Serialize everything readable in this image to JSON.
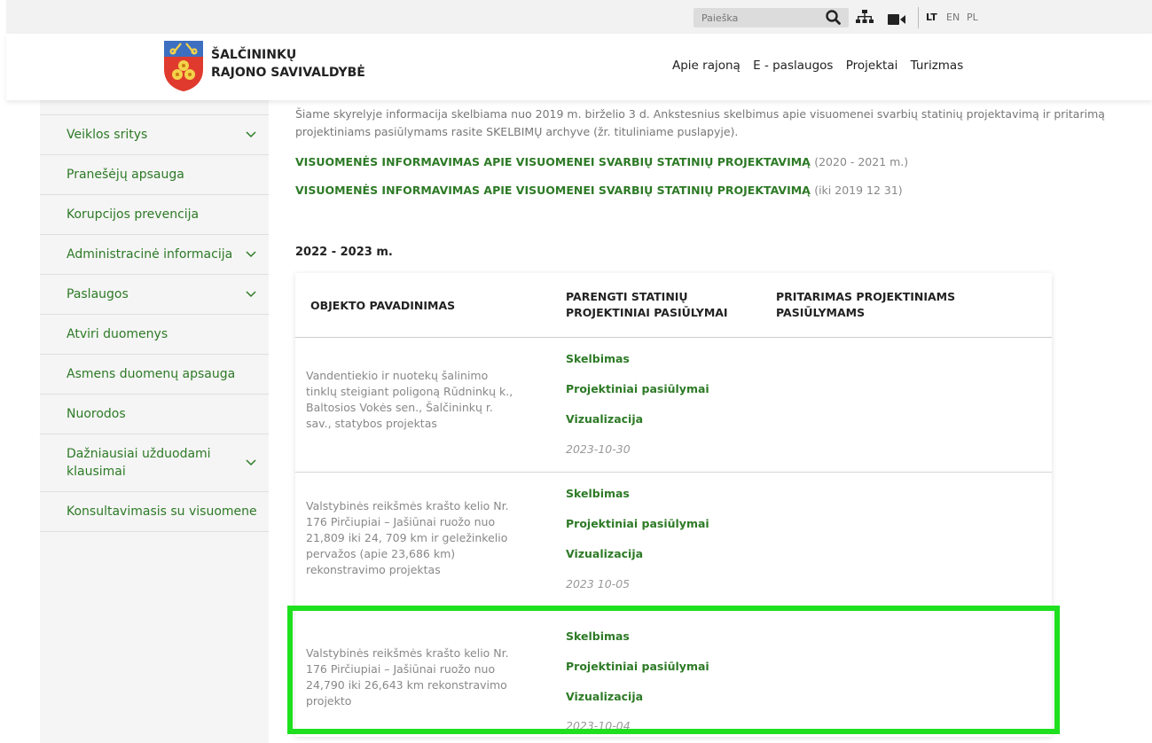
{
  "topbar": {
    "search_placeholder": "Paieška",
    "search_icon": "search-icon",
    "sitemap_icon": "sitemap-icon",
    "video_icon": "video-camera-icon",
    "languages": [
      "LT",
      "EN",
      "PL"
    ],
    "active_language": "LT"
  },
  "header": {
    "brand_line1": "ŠALČININKŲ",
    "brand_line2": "RAJONO SAVIVALDYBĖ",
    "nav": [
      "Apie rajoną",
      "E - paslaugos",
      "Projektai",
      "Turizmas"
    ]
  },
  "sidebar": {
    "items": [
      {
        "label": "Veiklos sritys",
        "expandable": true
      },
      {
        "label": "Pranešėjų apsauga",
        "expandable": false
      },
      {
        "label": "Korupcijos prevencija",
        "expandable": false
      },
      {
        "label": "Administracinė informacija",
        "expandable": true
      },
      {
        "label": "Paslaugos",
        "expandable": true
      },
      {
        "label": "Atviri duomenys",
        "expandable": false
      },
      {
        "label": "Asmens duomenų apsauga",
        "expandable": false
      },
      {
        "label": "Nuorodos",
        "expandable": false
      },
      {
        "label": "Dažniausiai užduodami klausimai",
        "expandable": true
      },
      {
        "label": "Konsultavimasis su visuomene",
        "expandable": false
      }
    ]
  },
  "content": {
    "intro": "Šiame skyrelyje informacija skelbiama nuo 2019 m. birželio 3 d. Ankstesnius skelbimus apie visuomenei svarbių statinių projektavimą ir pritarimą projektiniams pasiūlymams rasite SKELBIMŲ archyve (žr. tituliniame puslapyje).",
    "link1_text": "VISUOMENĖS INFORMAVIMAS APIE VISUOMENEI SVARBIŲ STATINIŲ PROJEKTAVIMĄ",
    "link1_years": "(2020 - 2021 m.)",
    "link2_text": "VISUOMENĖS INFORMAVIMAS APIE VISUOMENEI SVARBIŲ STATINIŲ PROJEKTAVIMĄ",
    "link2_years": "(iki 2019 12 31)",
    "year_heading": "2022 - 2023 m.",
    "table": {
      "headers": [
        "OBJEKTO PAVADINIMAS",
        "PARENGTI STATINIŲ PROJEKTINIAI PASIŪLYMAI",
        "PRITARIMAS PROJEKTINIAMS PASIŪLYMAMS"
      ],
      "rows": [
        {
          "object": "Vandentiekio ir nuotekų šalinimo tinklų steigiant poligoną Rūdninkų k., Baltosios Vokės sen., Šalčininkų r. sav., statybos projektas",
          "links": [
            "Skelbimas",
            "Projektiniai pasiūlymai",
            "Vizualizacija"
          ],
          "date": "2023-10-30"
        },
        {
          "object": "Valstybinės reikšmės krašto kelio Nr. 176 Pirčiupiai – Jašiūnai ruožo nuo 21,809 iki 24, 709 km ir geležinkelio pervažos (apie 23,686 km) rekonstravimo projektas",
          "links": [
            "Skelbimas",
            "Projektiniai pasiūlymai",
            "Vizualizacija"
          ],
          "date": "2023 10-05"
        },
        {
          "object": "Valstybinės reikšmės krašto kelio Nr. 176 Pirčiupiai – Jašiūnai ruožo nuo 24,790 iki 26,643 km rekonstravimo projekto",
          "links": [
            "Skelbimas",
            "Projektiniai pasiūlymai",
            "Vizualizacija"
          ],
          "date": "2023-10-04"
        }
      ]
    }
  },
  "colors": {
    "accent_green": "#2d7a26",
    "highlight_green": "#1ee01e"
  }
}
